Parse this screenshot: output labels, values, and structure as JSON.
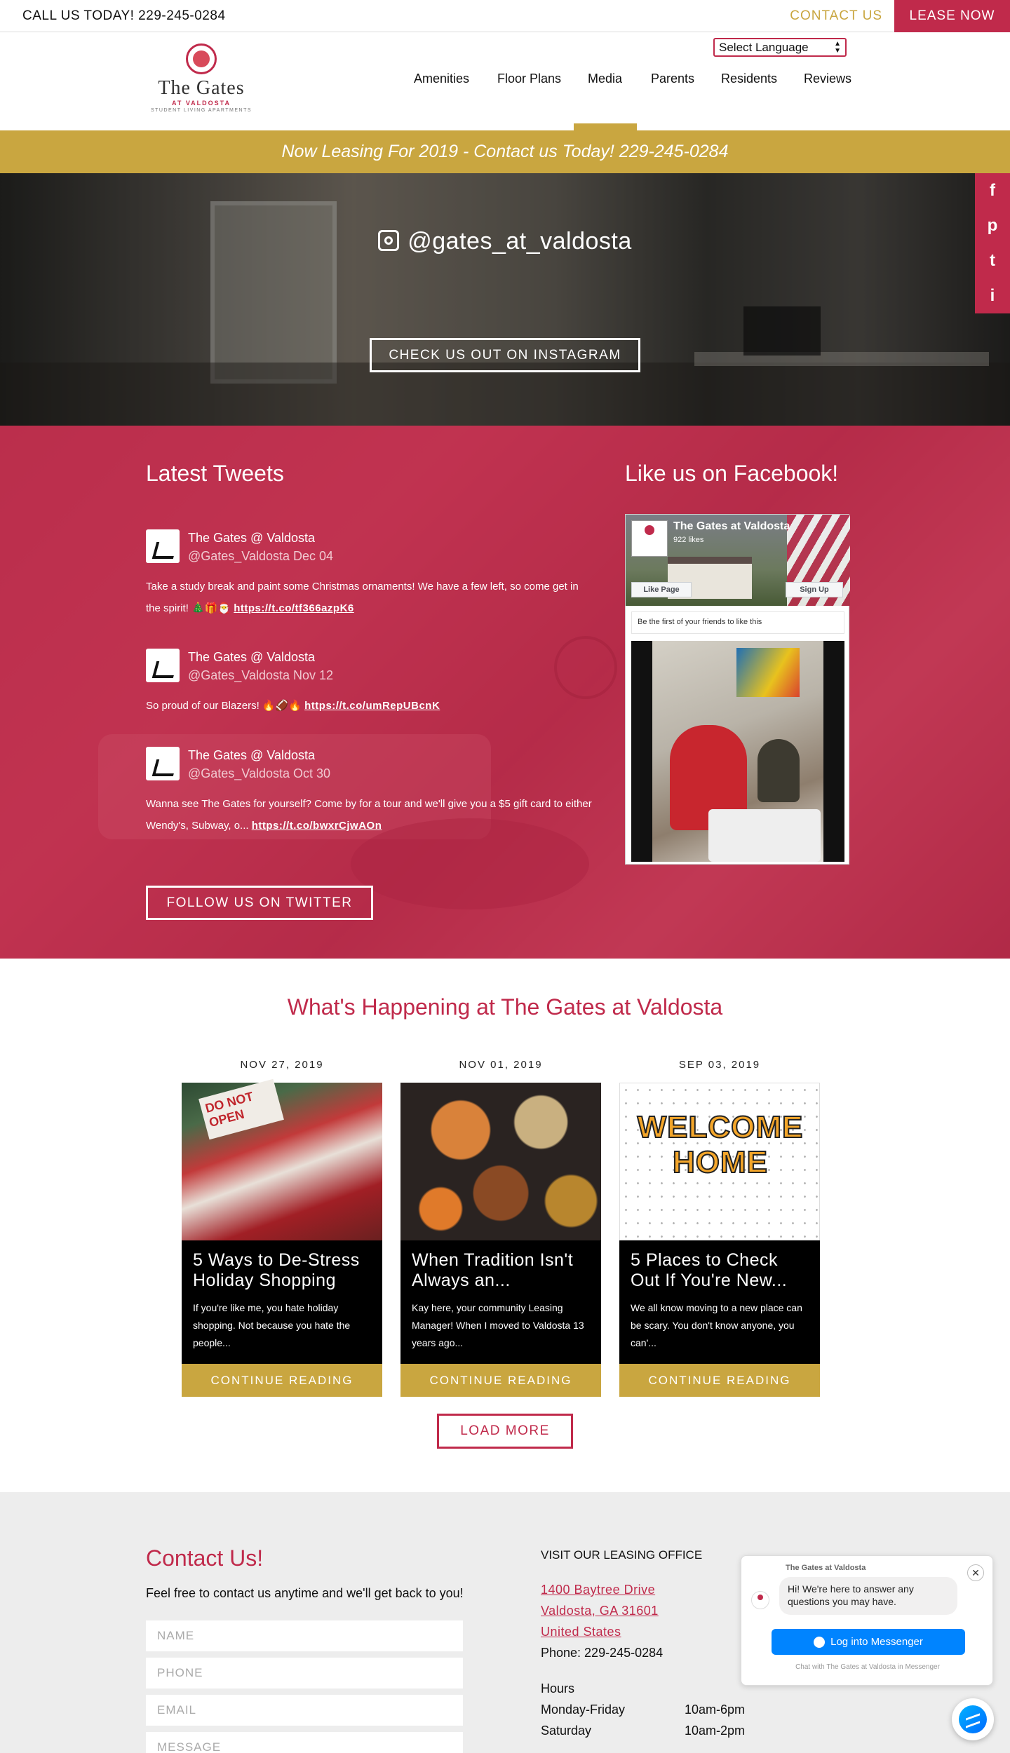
{
  "topbar": {
    "call": "CALL US TODAY! 229-245-0284",
    "contact": "CONTACT US",
    "lease": "LEASE NOW"
  },
  "header": {
    "logo": {
      "name": "The Gates",
      "sub": "AT VALDOSTA",
      "tagline": "STUDENT LIVING APARTMENTS"
    },
    "language": "Select Language",
    "nav": [
      "Amenities",
      "Floor Plans",
      "Media",
      "Parents",
      "Residents",
      "Reviews"
    ],
    "active_nav": "Media"
  },
  "banner": "Now Leasing For 2019 - Contact us Today! 229-245-0284",
  "instagram": {
    "handle": "@gates_at_valdosta",
    "button": "CHECK US OUT ON INSTAGRAM"
  },
  "social": {
    "icons": [
      "facebook-icon",
      "pinterest-icon",
      "twitter-icon",
      "instagram-icon"
    ],
    "glyphs": [
      "f",
      "p",
      "t",
      "i"
    ]
  },
  "tweets_section": {
    "title": "Latest Tweets",
    "tweets": [
      {
        "name": "The Gates @ Valdosta",
        "handle_date": "@Gates_Valdosta Dec 04",
        "text": "Take a study break and paint some Christmas ornaments! We have a few left, so come get in the spirit! 🎄🎁🎅 ",
        "link": "https://t.co/tf366azpK6"
      },
      {
        "name": "The Gates @ Valdosta",
        "handle_date": "@Gates_Valdosta Nov 12",
        "text": "So proud of our Blazers! 🔥🏈🔥 ",
        "link": "https://t.co/umRepUBcnK"
      },
      {
        "name": "The Gates @ Valdosta",
        "handle_date": "@Gates_Valdosta Oct 30",
        "text": "Wanna see The Gates for yourself? Come by for a tour and we'll give you a $5 gift card to either Wendy's, Subway, o... ",
        "link": "https://t.co/bwxrCjwAOn"
      }
    ],
    "follow_button": "FOLLOW US ON TWITTER"
  },
  "facebook": {
    "title": "Like us on Facebook!",
    "page_name": "The Gates at Valdosta",
    "likes": "922 likes",
    "like_button": "Like Page",
    "signup_button": "Sign Up",
    "friends_text": "Be the first of your friends to like this"
  },
  "blog": {
    "title": "What's Happening at The Gates at Valdosta",
    "posts": [
      {
        "date": "NOV 27, 2019",
        "title": "5 Ways to De-Stress Holiday Shopping",
        "excerpt": "If you're like me, you hate holiday shopping. Not because you hate the people...",
        "cta": "CONTINUE READING",
        "image_text": "DO NOT OPEN"
      },
      {
        "date": "NOV 01, 2019",
        "title": "When Tradition Isn't Always an...",
        "excerpt": "Kay here, your community Leasing Manager! When I moved to Valdosta 13 years ago...",
        "cta": "CONTINUE READING",
        "image_text": ""
      },
      {
        "date": "SEP 03, 2019",
        "title": "5 Places to Check Out If You're New...",
        "excerpt": "We all know moving to a new place can be scary. You don't know anyone, you can'...",
        "cta": "CONTINUE READING",
        "image_text": "WELCOME HOME"
      }
    ],
    "load_more": "LOAD MORE"
  },
  "contact": {
    "title": "Contact Us!",
    "intro": "Feel free to contact us anytime and we'll get back to you!",
    "fields": [
      "NAME",
      "PHONE",
      "EMAIL",
      "MESSAGE"
    ],
    "office_title": "VISIT OUR LEASING OFFICE",
    "address": [
      "1400 Baytree Drive",
      "Valdosta, GA 31601",
      "United States"
    ],
    "phone": "Phone: 229-245-0284",
    "hours_title": "Hours",
    "hours": [
      {
        "days": "Monday-Friday",
        "time": "10am-6pm"
      },
      {
        "days": "Saturday",
        "time": "10am-2pm"
      }
    ]
  },
  "messenger": {
    "from": "The Gates at Valdosta",
    "message": "Hi! We're here to answer any questions you may have.",
    "login": "Log into Messenger",
    "note": "Chat with The Gates at Valdosta in Messenger",
    "close": "✕"
  },
  "colors": {
    "brand_red": "#c02a4b",
    "gold": "#c9a640"
  }
}
